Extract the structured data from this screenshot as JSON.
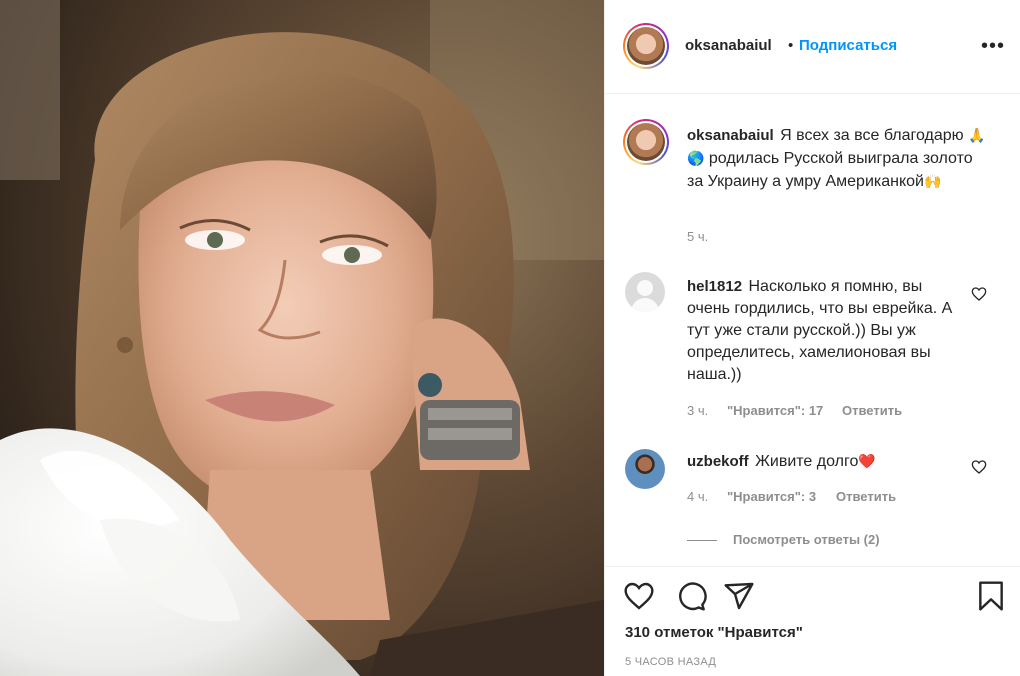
{
  "post": {
    "image_alt": "portrait photo",
    "author": {
      "username": "oksanabaiul",
      "separator": "•",
      "follow_label": "Подписаться",
      "more_icon": "more-horizontal-icon"
    },
    "caption": {
      "username": "oksanabaiul",
      "text_part1": "Я всех за все благодарю ",
      "emoji1": "🙏🌎",
      "text_part2": " родилась Русской выиграла золото за Украину а умру Американкой",
      "emoji2": "🙌",
      "time": "5 ч."
    },
    "comments": [
      {
        "username": "hel1812",
        "text": "Насколько я помню, вы очень гордились, что вы еврейка. А тут уже стали русской.)) Вы уж определитесь, хамелионовая вы наша.))",
        "time": "3 ч.",
        "likes": "\"Нравится\": 17",
        "reply_label": "Ответить"
      },
      {
        "username": "uzbekoff",
        "text": "Живите долго",
        "emoji": "❤️",
        "time": "4 ч.",
        "likes": "\"Нравится\": 3",
        "reply_label": "Ответить",
        "view_replies": "Посмотреть ответы (2)"
      }
    ],
    "actions": {
      "like_icon": "heart-icon",
      "comment_icon": "comment-icon",
      "share_icon": "share-icon",
      "save_icon": "bookmark-icon"
    },
    "likes_text": "310 отметок \"Нравится\"",
    "posted_time": "5 ЧАСОВ НАЗАД"
  },
  "colors": {
    "link_blue": "#0095f6",
    "text_primary": "#262626",
    "text_secondary": "#8e8e8e",
    "divider": "#efefef",
    "heart_red": "#ed4956"
  }
}
